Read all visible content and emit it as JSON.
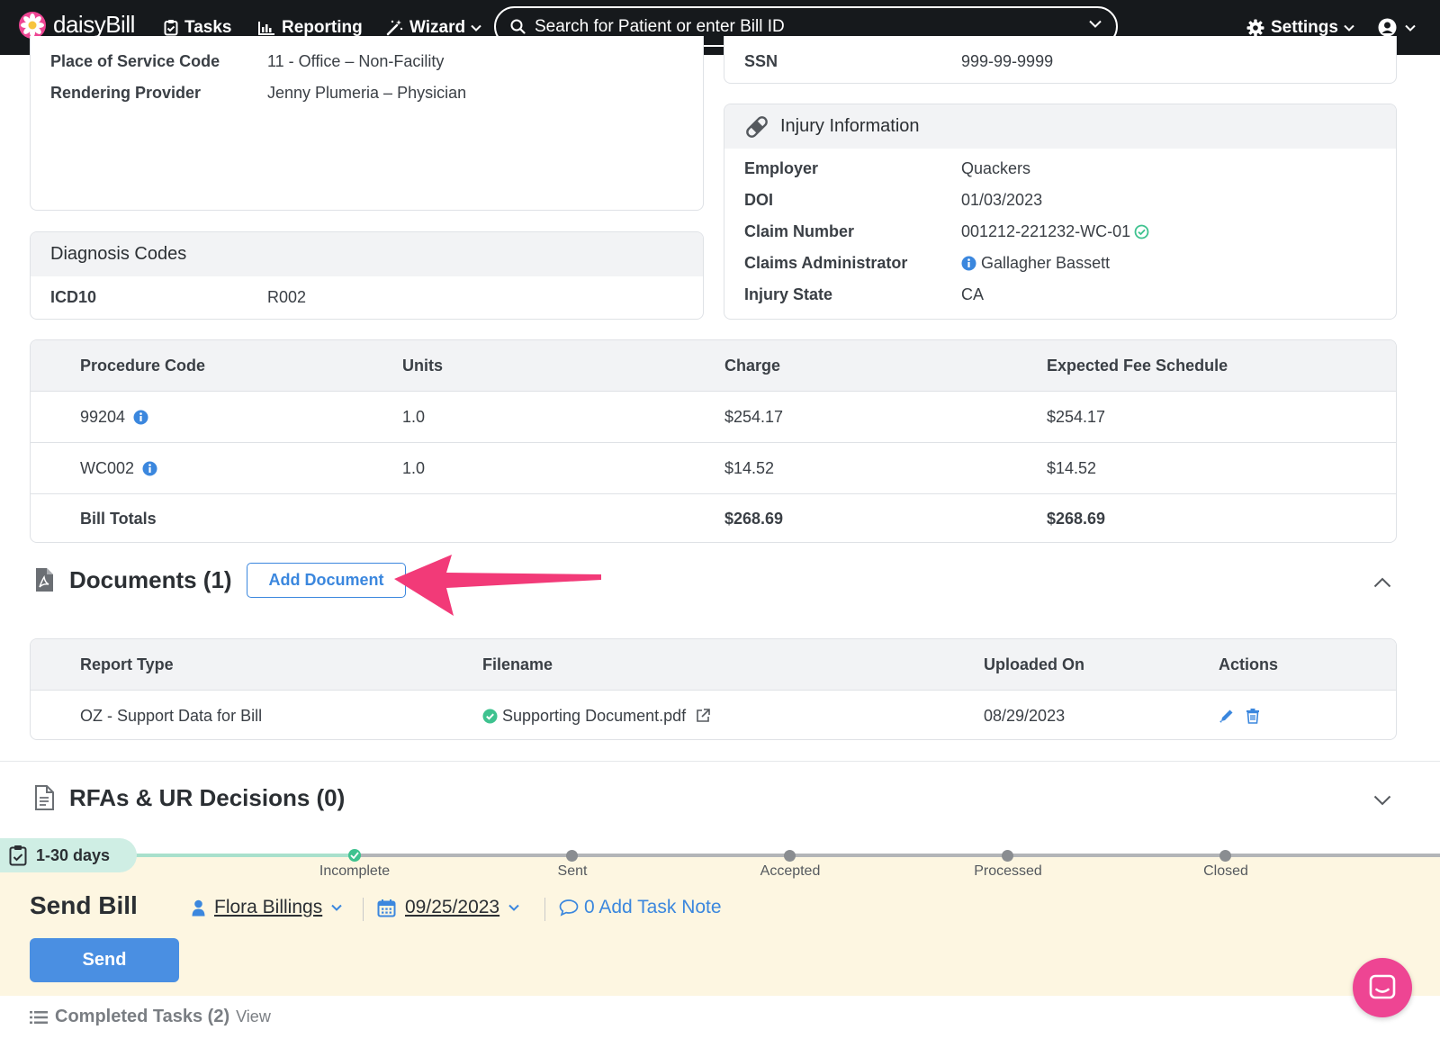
{
  "nav": {
    "brand": "daisyBill",
    "tasks": "Tasks",
    "reporting": "Reporting",
    "wizard": "Wizard",
    "search_placeholder": "Search for Patient or enter Bill ID",
    "settings": "Settings"
  },
  "bill_info": {
    "place_of_service_label": "Place of Service Code",
    "place_of_service_value": "11 - Office – Non-Facility",
    "rendering_provider_label": "Rendering Provider",
    "rendering_provider_value": "Jenny Plumeria – Physician"
  },
  "patient": {
    "ssn_label": "SSN",
    "ssn_value": "999-99-9999"
  },
  "injury": {
    "title": "Injury Information",
    "employer_label": "Employer",
    "employer_value": "Quackers",
    "doi_label": "DOI",
    "doi_value": "01/03/2023",
    "claim_number_label": "Claim Number",
    "claim_number_value": "001212-221232-WC-01",
    "claims_admin_label": "Claims Administrator",
    "claims_admin_value": "Gallagher Bassett",
    "injury_state_label": "Injury State",
    "injury_state_value": "CA"
  },
  "diagnosis": {
    "title": "Diagnosis Codes",
    "code_type": "ICD10",
    "code": "R002"
  },
  "procedures": {
    "headers": [
      "Procedure Code",
      "Units",
      "Charge",
      "Expected Fee Schedule"
    ],
    "rows": [
      {
        "code": "99204",
        "units": "1.0",
        "charge": "$254.17",
        "expected": "$254.17"
      },
      {
        "code": "WC002",
        "units": "1.0",
        "charge": "$14.52",
        "expected": "$14.52"
      }
    ],
    "totals_label": "Bill Totals",
    "totals_charge": "$268.69",
    "totals_expected": "$268.69"
  },
  "documents": {
    "title": "Documents (1)",
    "add_button": "Add Document",
    "headers": [
      "Report Type",
      "Filename",
      "Uploaded On",
      "Actions"
    ],
    "rows": [
      {
        "report_type": "OZ - Support Data for Bill",
        "filename": "Supporting Document.pdf",
        "uploaded_on": "08/29/2023"
      }
    ]
  },
  "rfas": {
    "title": "RFAs & UR Decisions (0)"
  },
  "task": {
    "age_badge": "1-30 days",
    "steps": [
      "Incomplete",
      "Sent",
      "Accepted",
      "Processed",
      "Closed"
    ],
    "title": "Send Bill",
    "assignee": "Flora Billings",
    "due_date": "09/25/2023",
    "note_link": "0 Add Task Note",
    "send_button": "Send",
    "completed_label": "Completed Tasks (2)",
    "completed_view": "View"
  },
  "colors": {
    "nav_bg": "#16191c",
    "accent_blue": "#3b87de",
    "task_bg": "#fdf6e1",
    "success_green": "#3ec28f",
    "annotation_arrow": "#f23a78",
    "chat_button": "#ee4593"
  }
}
